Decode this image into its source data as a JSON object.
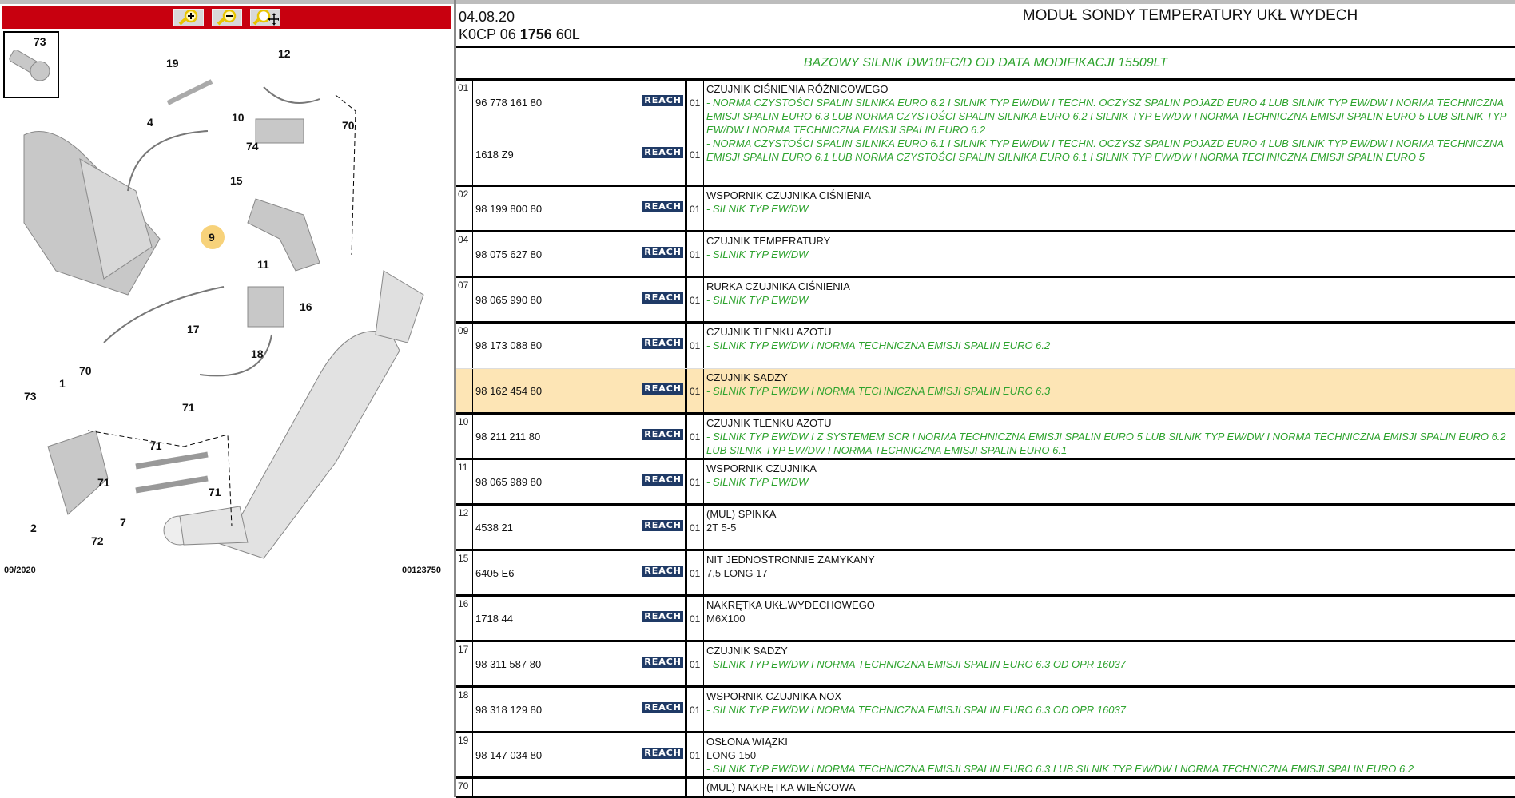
{
  "toolbar": {
    "zoom_in": "zoom-in",
    "zoom_out": "zoom-out",
    "zoom_pan": "zoom-pan"
  },
  "diagram": {
    "callouts": [
      "73",
      "19",
      "12",
      "4",
      "10",
      "70",
      "74",
      "15",
      "9",
      "11",
      "16",
      "17",
      "18",
      "70",
      "1",
      "73",
      "71",
      "71",
      "71",
      "71",
      "7",
      "2",
      "72"
    ],
    "date": "09/2020",
    "code": "00123750",
    "highlight_color": "#f7d27a"
  },
  "header": {
    "date": "04.08.20",
    "code_a": "K0CP 06 ",
    "code_b": "1756",
    "code_c": " 60L",
    "title": "MODUŁ SONDY TEMPERATURY UKŁ WYDECH",
    "subtitle": "BAZOWY SILNIK DW10FC/D OD DATA MODIFIKACJI 15509LT"
  },
  "colors": {
    "accent_red": "#c8000f",
    "green": "#2ea32e",
    "highlight": "#fde5b5",
    "reach": "#1f3a66"
  },
  "reach_label": "REACH",
  "rows": [
    {
      "idx": "01",
      "title": "CZUJNIK CIŚNIENIA RÓŻNICOWEGO",
      "parts": [
        {
          "ref": "96 778 161 80",
          "qty": "01",
          "note": "- NORMA CZYSTOŚCI SPALIN SILNIKA EURO 6.2 I SILNIK TYP EW/DW I TECHN. OCZYSZ SPALIN POJAZD EURO 4 LUB SILNIK TYP EW/DW I NORMA TECHNICZNA EMISJI SPALIN EURO 6.3 LUB NORMA CZYSTOŚCI SPALIN SILNIKA EURO 6.2 I SILNIK TYP EW/DW I NORMA TECHNICZNA EMISJI SPALIN EURO 5 LUB SILNIK TYP EW/DW I NORMA TECHNICZNA EMISJI SPALIN EURO 6.2"
        },
        {
          "ref": "1618 Z9",
          "qty": "01",
          "note": "- NORMA CZYSTOŚCI SPALIN SILNIKA EURO 6.1 I SILNIK TYP EW/DW I TECHN. OCZYSZ SPALIN POJAZD EURO 4 LUB SILNIK TYP EW/DW I NORMA TECHNICZNA EMISJI SPALIN EURO 6.1 LUB NORMA CZYSTOŚCI SPALIN SILNIKA EURO 6.1 I SILNIK TYP EW/DW I NORMA TECHNICZNA EMISJI SPALIN EURO 5"
        }
      ]
    },
    {
      "idx": "02",
      "title": "WSPORNIK CZUJNIKA CIŚNIENIA",
      "parts": [
        {
          "ref": "98 199 800 80",
          "qty": "01",
          "note": "- SILNIK TYP EW/DW"
        }
      ]
    },
    {
      "idx": "04",
      "title": "CZUJNIK TEMPERATURY",
      "parts": [
        {
          "ref": "98 075 627 80",
          "qty": "01",
          "note": "- SILNIK TYP EW/DW"
        }
      ]
    },
    {
      "idx": "07",
      "title": "RURKA CZUJNIKA CIŚNIENIA",
      "parts": [
        {
          "ref": "98 065 990 80",
          "qty": "01",
          "note": "- SILNIK TYP EW/DW"
        }
      ]
    },
    {
      "idx": "09",
      "title": "CZUJNIK TLENKU AZOTU",
      "parts": [
        {
          "ref": "98 173 088 80",
          "qty": "01",
          "note": "- SILNIK TYP EW/DW I NORMA TECHNICZNA EMISJI SPALIN EURO 6.2"
        }
      ],
      "cont": true
    },
    {
      "idx": "",
      "title": "CZUJNIK SADZY",
      "highlight": true,
      "parts": [
        {
          "ref": "98 162 454 80",
          "qty": "01",
          "note": "- SILNIK TYP EW/DW I NORMA TECHNICZNA EMISJI SPALIN EURO 6.3"
        }
      ]
    },
    {
      "idx": "10",
      "title": "CZUJNIK TLENKU AZOTU",
      "parts": [
        {
          "ref": "98 211 211 80",
          "qty": "01",
          "note": "- SILNIK TYP EW/DW I Z SYSTEMEM SCR I NORMA TECHNICZNA EMISJI SPALIN EURO 5 LUB SILNIK TYP EW/DW I NORMA TECHNICZNA EMISJI SPALIN EURO 6.2 LUB SILNIK TYP EW/DW I NORMA TECHNICZNA EMISJI SPALIN EURO 6.1"
        }
      ]
    },
    {
      "idx": "11",
      "title": "WSPORNIK CZUJNIKA",
      "parts": [
        {
          "ref": "98 065 989 80",
          "qty": "01",
          "note": "- SILNIK TYP EW/DW"
        }
      ]
    },
    {
      "idx": "12",
      "title": "(MUL) SPINKA",
      "parts": [
        {
          "ref": "4538 21",
          "qty": "01",
          "plain": "2T 5-5"
        }
      ]
    },
    {
      "idx": "15",
      "title": "NIT JEDNOSTRONNIE ZAMYKANY",
      "parts": [
        {
          "ref": "6405 E6",
          "qty": "01",
          "plain": "7,5 LONG 17"
        }
      ]
    },
    {
      "idx": "16",
      "title": "NAKRĘTKA UKŁ.WYDECHOWEGO",
      "parts": [
        {
          "ref": "1718 44",
          "qty": "01",
          "plain": "M6X100"
        }
      ]
    },
    {
      "idx": "17",
      "title": "CZUJNIK SADZY",
      "parts": [
        {
          "ref": "98 311 587 80",
          "qty": "01",
          "note": "- SILNIK TYP EW/DW I NORMA TECHNICZNA EMISJI SPALIN EURO 6.3 OD OPR 16037"
        }
      ]
    },
    {
      "idx": "18",
      "title": "WSPORNIK CZUJNIKA NOX",
      "parts": [
        {
          "ref": "98 318 129 80",
          "qty": "01",
          "note": "- SILNIK TYP EW/DW I NORMA TECHNICZNA EMISJI SPALIN EURO 6.3 OD OPR 16037"
        }
      ]
    },
    {
      "idx": "19",
      "title": "OSŁONA WIĄZKI",
      "parts": [
        {
          "ref": "98 147 034 80",
          "qty": "01",
          "plain": "LONG 150",
          "note": "- SILNIK TYP EW/DW I NORMA TECHNICZNA EMISJI SPALIN EURO 6.3 LUB SILNIK TYP EW/DW I NORMA TECHNICZNA EMISJI SPALIN EURO 6.2"
        }
      ]
    },
    {
      "idx": "70",
      "title": "(MUL) NAKRĘTKA WIEŃCOWA",
      "parts": [
        {
          "ref": "",
          "qty": ""
        }
      ]
    }
  ]
}
